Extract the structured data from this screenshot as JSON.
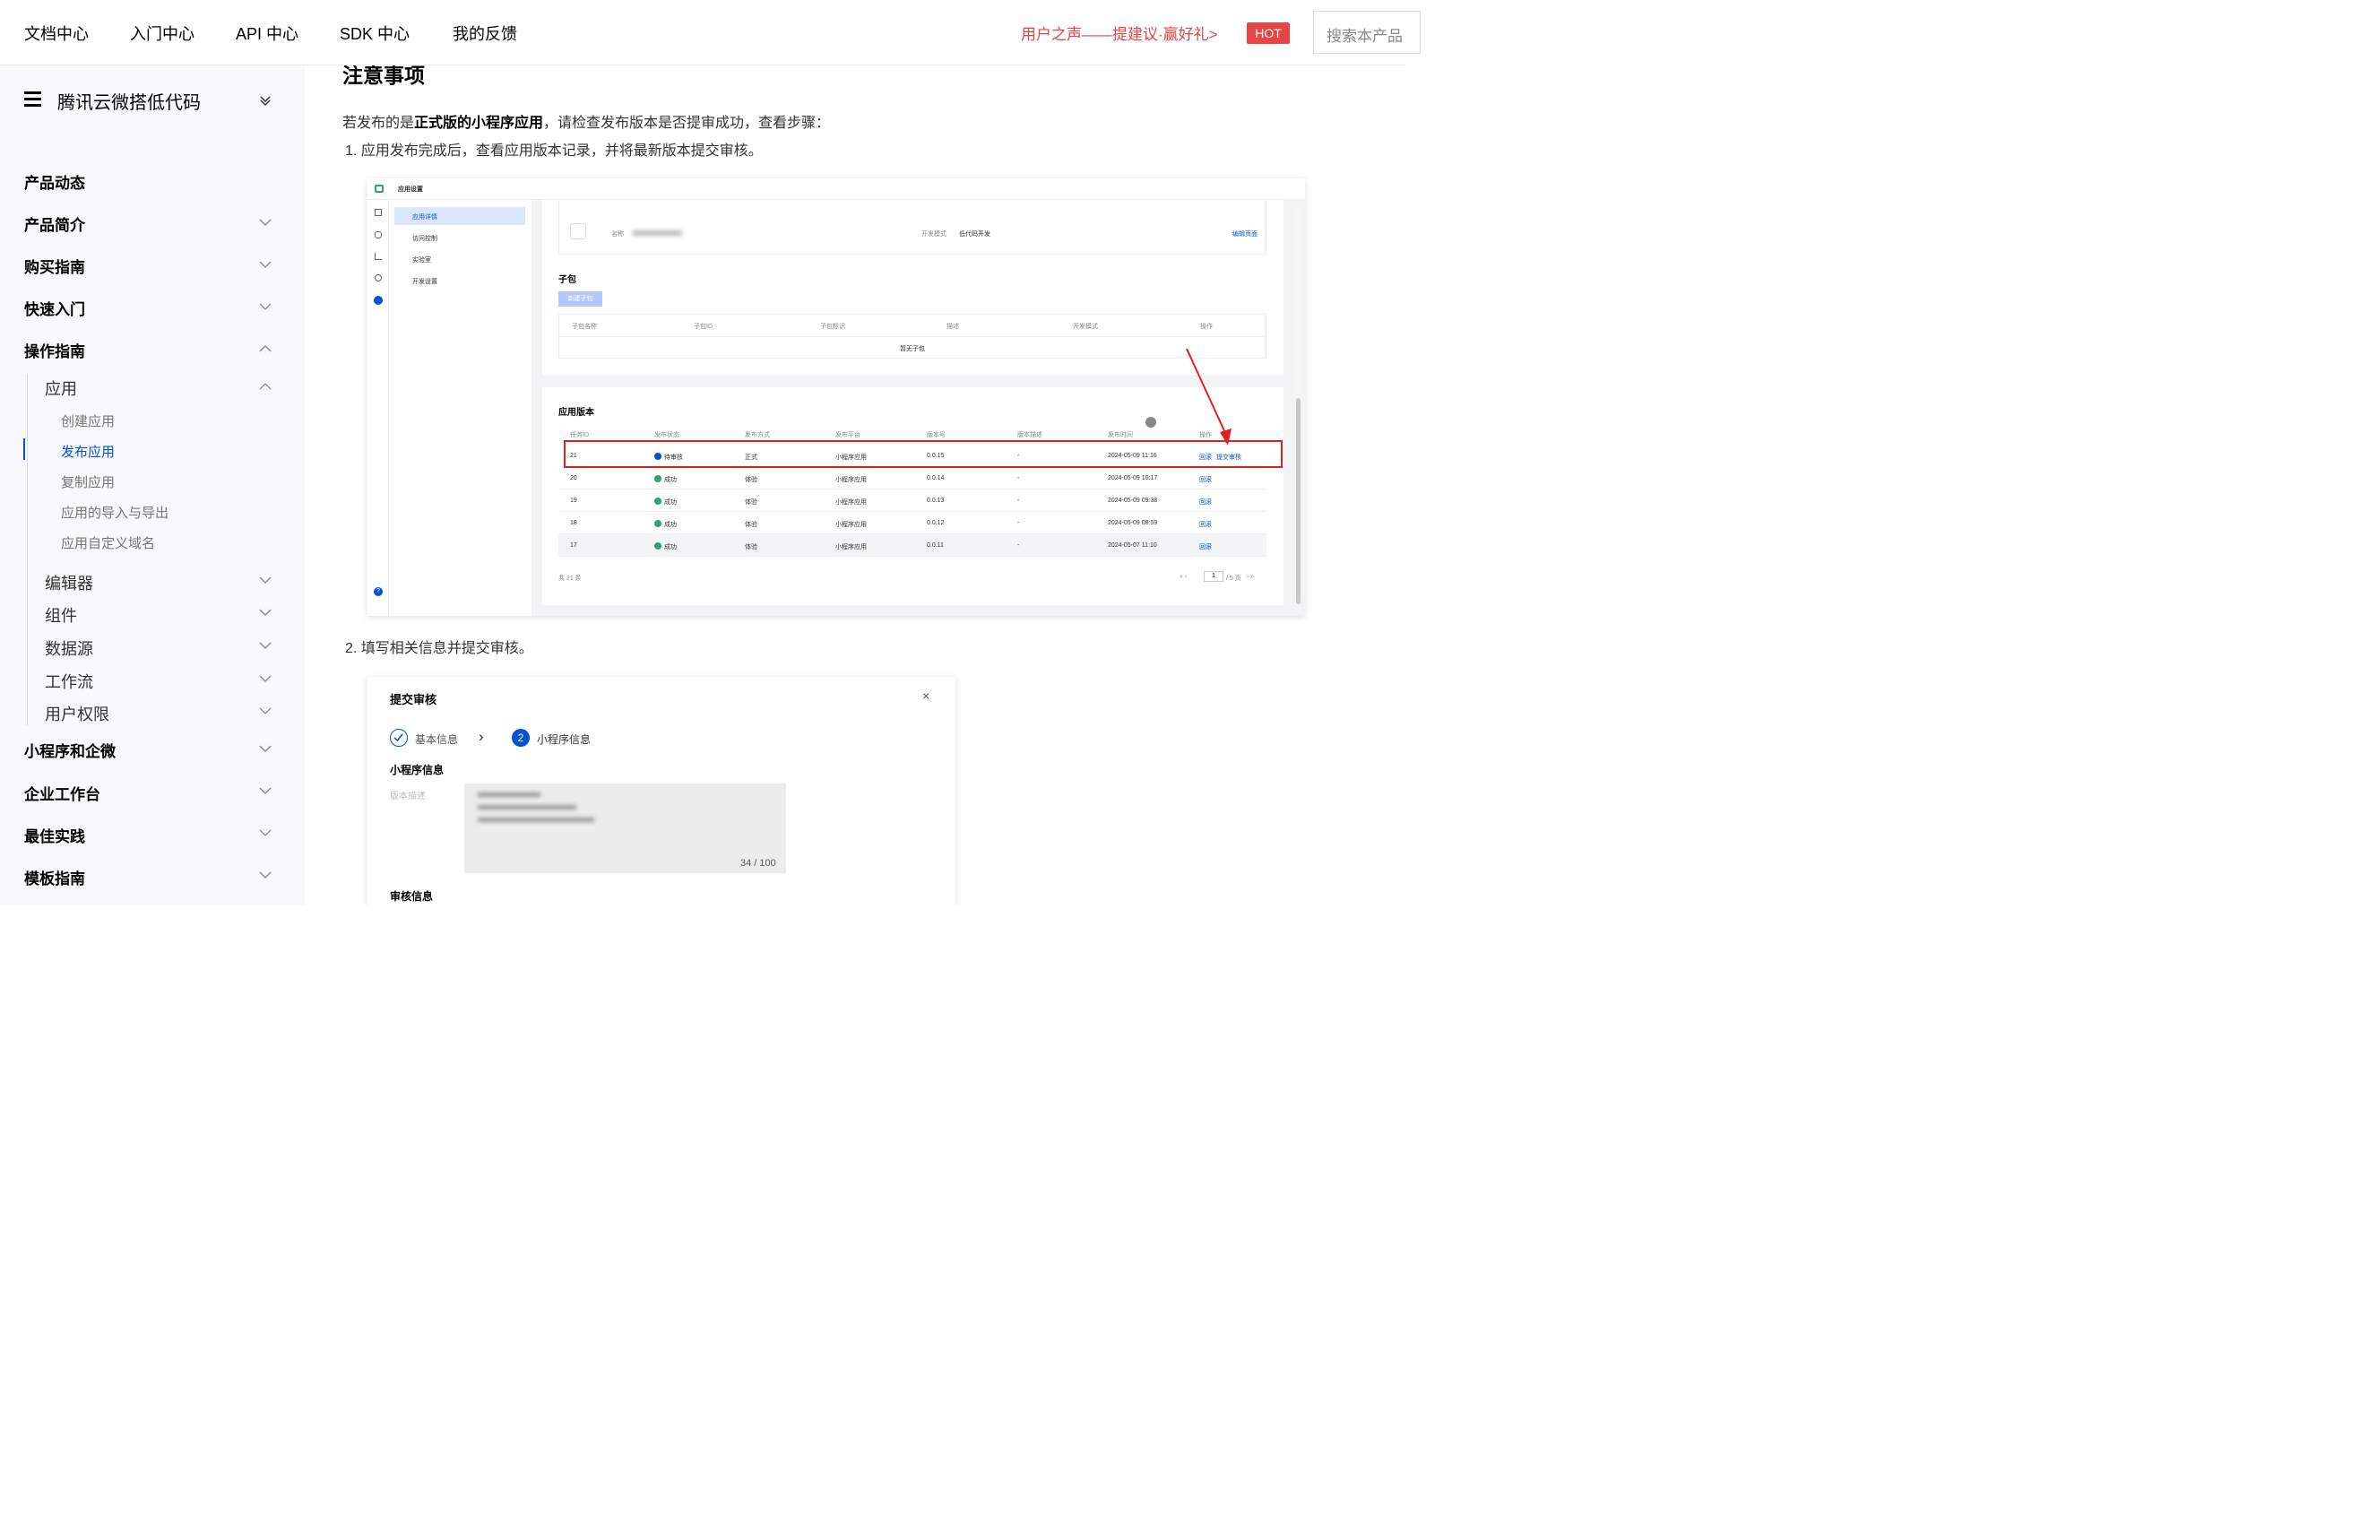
{
  "topnav": {
    "items": [
      "文档中心",
      "入门中心",
      "API 中心",
      "SDK 中心",
      "我的反馈"
    ],
    "promo": "用户之声——提建议·赢好礼>",
    "hot": "HOT",
    "search_placeholder": "搜索本产品"
  },
  "sidebar": {
    "product": "腾讯云微搭低代码",
    "sections": [
      "产品动态",
      "产品简介",
      "购买指南",
      "快速入门",
      "操作指南"
    ],
    "sub_app": "应用",
    "app_items": [
      "创建应用",
      "发布应用",
      "复制应用",
      "应用的导入与导出",
      "应用自定义域名"
    ],
    "sub_items": [
      "编辑器",
      "组件",
      "数据源",
      "工作流",
      "用户权限"
    ],
    "bottom_sections": [
      "小程序和企微",
      "企业工作台",
      "最佳实践",
      "模板指南"
    ]
  },
  "content": {
    "heading": "注意事项",
    "intro_pre": "若发布的是",
    "intro_bold": "正式版的小程序应用",
    "intro_post": "，请检查发布版本是否提审成功，查看步骤：",
    "step1": "1.  应用发布完成后，查看应用版本记录，并将最新版本提交审核。",
    "step2": "2.  填写相关信息并提交审核。"
  },
  "shot1": {
    "title": "应用设置",
    "menu": [
      "应用详情",
      "访问控制",
      "实验室",
      "开发设置"
    ],
    "info": {
      "name_label": "名称",
      "dev_mode_label": "开发模式",
      "dev_mode_value": "低代码开发",
      "edit_link": "编辑页面"
    },
    "subpkg": {
      "title": "子包",
      "new_button": "新建子包",
      "columns": [
        "子包名称",
        "子包ID",
        "子包标识",
        "描述",
        "开发模式",
        "操作"
      ],
      "empty": "暂无子包"
    },
    "versions": {
      "title": "应用版本",
      "columns": [
        "任务ID",
        "发布状态",
        "发布方式",
        "发布平台",
        "版本号",
        "版本描述",
        "发布时间",
        "操作"
      ],
      "rows": [
        {
          "id": "21",
          "status": "待审核",
          "status_color": "#0052d9",
          "mode": "正式",
          "platform": "小程序应用",
          "version": "0.0.15",
          "desc": "-",
          "time": "2024-05-09 11:16",
          "op1": "回滚",
          "op2": "提交审核"
        },
        {
          "id": "20",
          "status": "成功",
          "status_color": "#2ba471",
          "mode": "体验",
          "platform": "小程序应用",
          "version": "0.0.14",
          "desc": "-",
          "time": "2024-05-09 10:17",
          "op1": "回滚",
          "op2": ""
        },
        {
          "id": "19",
          "status": "成功",
          "status_color": "#2ba471",
          "mode": "体验",
          "platform": "小程序应用",
          "version": "0.0.13",
          "desc": "-",
          "time": "2024-05-09 09:38",
          "op1": "回滚",
          "op2": ""
        },
        {
          "id": "18",
          "status": "成功",
          "status_color": "#2ba471",
          "mode": "体验",
          "platform": "小程序应用",
          "version": "0.0.12",
          "desc": "-",
          "time": "2024-05-09 08:59",
          "op1": "回滚",
          "op2": ""
        },
        {
          "id": "17",
          "status": "成功",
          "status_color": "#2ba471",
          "mode": "体验",
          "platform": "小程序应用",
          "version": "0.0.11",
          "desc": "-",
          "time": "2024-05-07 11:10",
          "op1": "回滚",
          "op2": ""
        }
      ],
      "total": "共 21 条",
      "page": "1",
      "pages": "/ 5 页"
    }
  },
  "shot2": {
    "title": "提交审核",
    "close": "×",
    "step1": "基本信息",
    "step2_num": "2",
    "step2": "小程序信息",
    "section1": "小程序信息",
    "desc_label": "版本描述",
    "counter": "34 / 100",
    "section2": "审核信息"
  },
  "colors": {
    "brand": "#0052d9",
    "promo": "#e54545",
    "annotation": "#e02020"
  }
}
